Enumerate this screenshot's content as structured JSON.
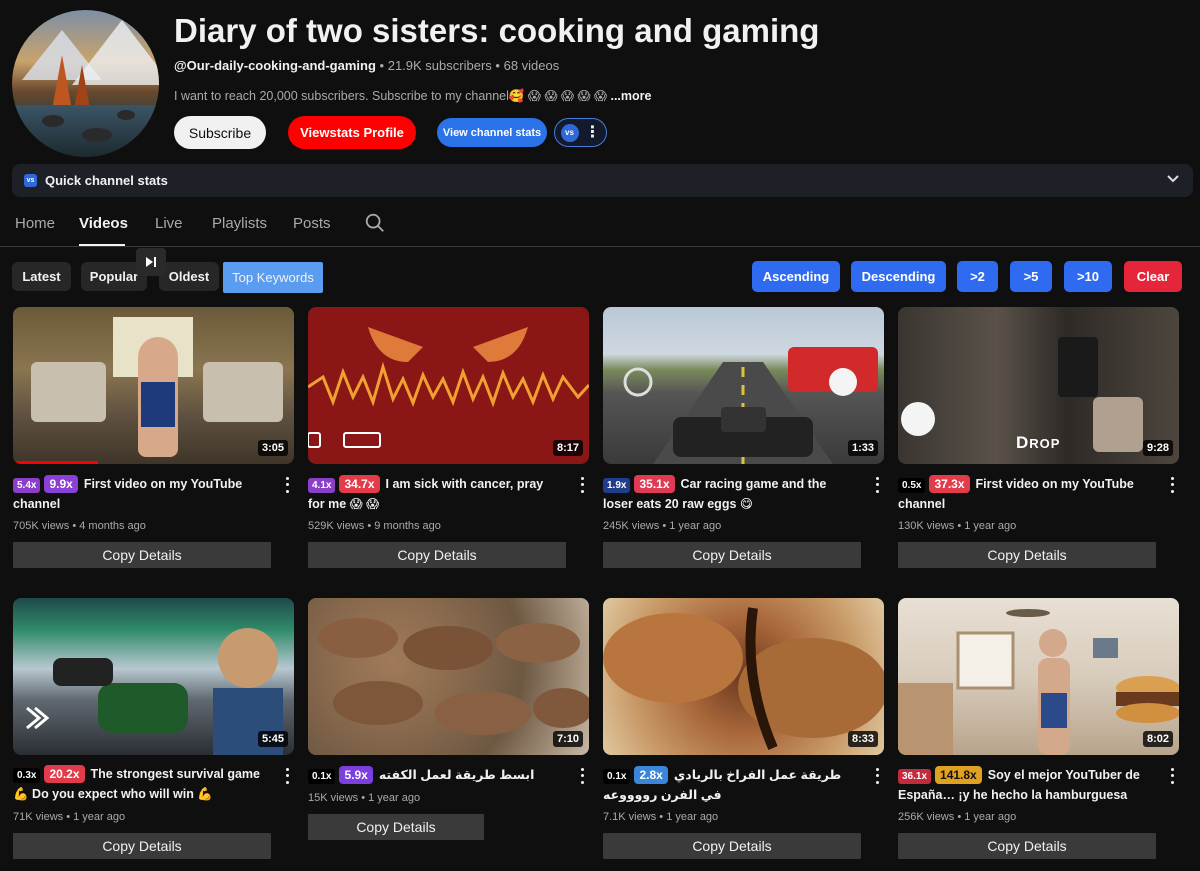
{
  "channel": {
    "title": "Diary of two sisters: cooking and gaming",
    "handle": "@Our-daily-cooking-and-gaming",
    "subscribers": "21.9K subscribers",
    "videos": "68 videos",
    "description": "I want to reach 20,000 subscribers. Subscribe to my channel🥰 😱 😱 😱 😱 😱",
    "more_label": "...more",
    "subscribe_label": "Subscribe",
    "viewstats_label": "Viewstats Profile",
    "channel_stats_label": "View channel stats"
  },
  "quickbar": {
    "label": "Quick channel stats",
    "logo": "vs"
  },
  "tabs": [
    {
      "label": "Home"
    },
    {
      "label": "Videos"
    },
    {
      "label": "Live"
    },
    {
      "label": "Playlists"
    },
    {
      "label": "Posts"
    }
  ],
  "sort": {
    "latest": "Latest",
    "popular": "Popular",
    "oldest": "Oldest",
    "top_keywords": "Top Keywords"
  },
  "filters": {
    "ascending": "Ascending",
    "descending": "Descending",
    "gt2": ">2",
    "gt5": ">5",
    "gt10": ">10",
    "clear": "Clear"
  },
  "copy_label": "Copy Details",
  "videos": [
    {
      "duration": "3:05",
      "small": "5.4x",
      "big": "9.9x",
      "title": "First video on my YouTube channel",
      "views": "705K views",
      "age": "4 months ago"
    },
    {
      "duration": "8:17",
      "small": "4.1x",
      "big": "34.7x",
      "title": "I am sick with cancer, pray for me 😱 😱",
      "views": "529K views",
      "age": "9 months ago"
    },
    {
      "duration": "1:33",
      "small": "1.9x",
      "big": "35.1x",
      "title": "Car racing game and the loser eats 20 raw eggs 😋",
      "views": "245K views",
      "age": "1 year ago"
    },
    {
      "duration": "9:28",
      "small": "0.5x",
      "big": "37.3x",
      "title": "First video on my YouTube channel",
      "views": "130K views",
      "age": "1 year ago"
    },
    {
      "duration": "5:45",
      "small": "0.3x",
      "big": "20.2x",
      "title": "The strongest survival game 💪 Do you expect who will win 💪",
      "views": "71K views",
      "age": "1 year ago"
    },
    {
      "duration": "7:10",
      "small": "0.1x",
      "big": "5.9x",
      "title": "ابسط طريقة لعمل الكفته",
      "views": "15K views",
      "age": "1 year ago"
    },
    {
      "duration": "8:33",
      "small": "0.1x",
      "big": "2.8x",
      "title": "طريقة عمل الفراخ بالريادي في الفرن رووووعه",
      "views": "7.1K views",
      "age": "1 year ago"
    },
    {
      "duration": "8:02",
      "small": "36.1x",
      "big": "141.8x",
      "title": "Soy el mejor YouTuber de España… ¡y he hecho la hamburguesa más…",
      "views": "256K views",
      "age": "1 year ago"
    }
  ],
  "separator": "•"
}
